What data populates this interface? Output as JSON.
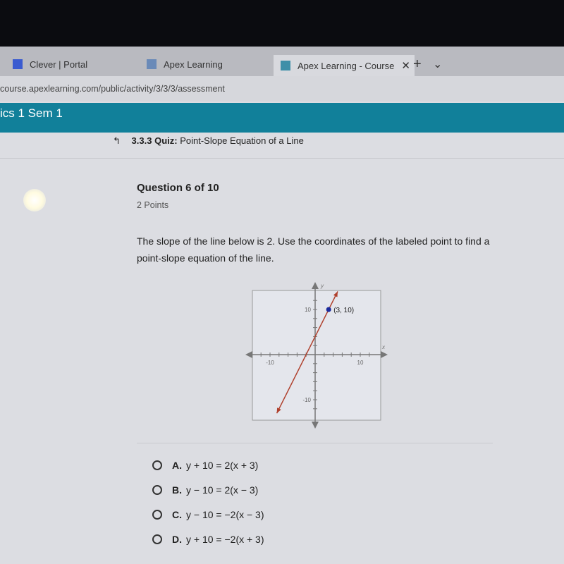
{
  "browser": {
    "tabs": [
      {
        "label": "Clever | Portal",
        "icon": "clever-icon"
      },
      {
        "label": "Apex Learning",
        "icon": "apex-icon"
      },
      {
        "label": "Apex Learning - Course",
        "icon": "apex-icon",
        "active": true
      }
    ],
    "close_glyph": "✕",
    "new_tab_glyph": "+",
    "menu_glyph": "⌄",
    "url": "course.apexlearning.com/public/activity/3/3/3/assessment"
  },
  "course_title": "ics 1 Sem 1",
  "breadcrumb": {
    "number": "3.3.3",
    "type": "Quiz:",
    "title": "Point-Slope Equation of a Line"
  },
  "question": {
    "header": "Question 6 of 10",
    "points": "2 Points",
    "prompt": "The slope of the line below is 2. Use the coordinates of the labeled point to find a point-slope equation of the line."
  },
  "chart_data": {
    "type": "line",
    "xlabel": "x",
    "ylabel": "y",
    "xlim": [
      -14,
      14
    ],
    "ylim": [
      -14,
      14
    ],
    "x_ticks": [
      {
        "value": -10,
        "label": "-10"
      },
      {
        "value": 10,
        "label": "10"
      }
    ],
    "y_ticks": [
      {
        "value": 10,
        "label": "10"
      },
      {
        "value": -10,
        "label": "-10"
      }
    ],
    "line": {
      "slope": 2,
      "intercept": 4,
      "from": [
        -8.5,
        -13
      ],
      "to": [
        5,
        14
      ],
      "color": "#b0402c"
    },
    "point": {
      "x": 3,
      "y": 10,
      "label": "(3, 10)",
      "color": "#1a2a9c"
    }
  },
  "options": [
    {
      "letter": "A.",
      "text": "y + 10 = 2(x + 3)"
    },
    {
      "letter": "B.",
      "text": "y − 10 = 2(x − 3)"
    },
    {
      "letter": "C.",
      "text": "y − 10 = −2(x − 3)"
    },
    {
      "letter": "D.",
      "text": "y + 10 = −2(x + 3)"
    }
  ]
}
